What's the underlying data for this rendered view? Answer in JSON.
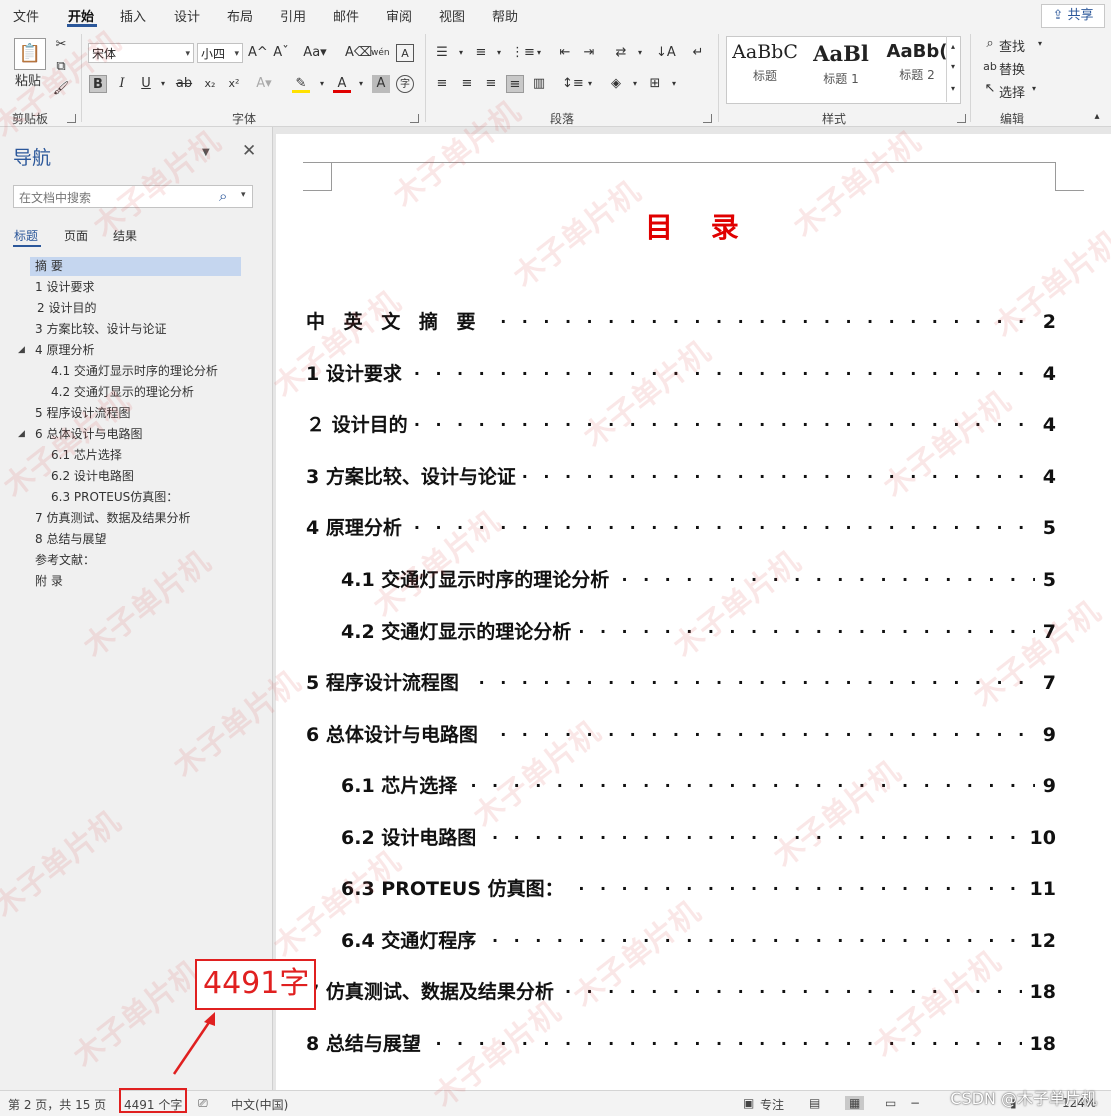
{
  "menu": {
    "items": [
      "文件",
      "开始",
      "插入",
      "设计",
      "布局",
      "引用",
      "邮件",
      "审阅",
      "视图",
      "帮助"
    ],
    "active": "开始",
    "share_label": "共享"
  },
  "ribbon": {
    "clipboard": {
      "paste_label": "粘贴",
      "group_label": "剪贴板"
    },
    "font": {
      "font_name": "宋体",
      "font_size": "小四",
      "group_label": "字体"
    },
    "paragraph": {
      "group_label": "段落"
    },
    "styles": {
      "group_label": "样式",
      "items": [
        {
          "preview": "AaBbC",
          "name": "标题"
        },
        {
          "preview": "AaBl",
          "name": "标题 1"
        },
        {
          "preview": "AaBb(",
          "name": "标题 2"
        }
      ]
    },
    "editing": {
      "find_label": "查找",
      "replace_label": "替换",
      "select_label": "选择",
      "group_label": "编辑"
    }
  },
  "nav": {
    "title": "导航",
    "search_placeholder": "在文档中搜索",
    "tabs": [
      "标题",
      "页面",
      "结果"
    ],
    "items": [
      "摘 要",
      "1 设计要求",
      "2 设计目的",
      "3 方案比较、设计与论证",
      "4 原理分析",
      "4.1 交通灯显示时序的理论分析",
      "4.2 交通灯显示的理论分析",
      "5 程序设计流程图",
      "6 总体设计与电路图",
      "6.1 芯片选择",
      "6.2 设计电路图",
      "6.3 PROTEUS仿真图：",
      "7 仿真测试、数据及结果分析",
      "8 总结与展望",
      "参考文献：",
      "附 录"
    ]
  },
  "document": {
    "title": "目 录",
    "toc": [
      {
        "label": "中 英 文 摘 要",
        "page": "2"
      },
      {
        "label": "1  设计要求",
        "page": "4"
      },
      {
        "label": "２  设计目的",
        "page": "4"
      },
      {
        "label": "3  方案比较、设计与论证",
        "page": "4"
      },
      {
        "label": "4  原理分析",
        "page": "5"
      },
      {
        "label": "4.1 交通灯显示时序的理论分析",
        "page": "5"
      },
      {
        "label": "4.2 交通灯显示的理论分析",
        "page": "7"
      },
      {
        "label": "5  程序设计流程图",
        "page": "7"
      },
      {
        "label": "6  总体设计与电路图",
        "page": "9"
      },
      {
        "label": "6.1  芯片选择",
        "page": "9"
      },
      {
        "label": "6.2  设计电路图",
        "page": "10"
      },
      {
        "label": "6.3  PROTEUS 仿真图：",
        "page": "11"
      },
      {
        "label": "6.4  交通灯程序",
        "page": "12"
      },
      {
        "label": "7 仿真测试、数据及结果分析",
        "page": "18"
      },
      {
        "label": "8 总结与展望",
        "page": "18"
      }
    ]
  },
  "annotation": {
    "text": "4491字"
  },
  "watermark": {
    "text": "木子单片机"
  },
  "status": {
    "page": "第 2 页，共 15 页",
    "words": "4491 个字",
    "language": "中文(中国)",
    "focus": "专注",
    "zoom": "124%"
  },
  "credit": "CSDN @木子单片机",
  "colors": {
    "accent": "#2b579a",
    "toc_title": "#e00000",
    "annotation": "#e02020"
  }
}
